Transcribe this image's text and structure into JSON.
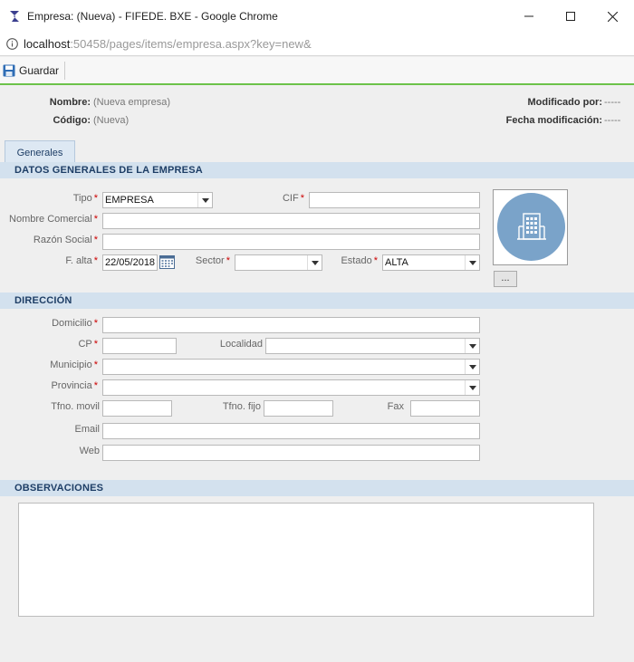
{
  "window": {
    "title": "Empresa: (Nueva) - FIFEDE. BXE - Google Chrome"
  },
  "address": {
    "host": "localhost",
    "rest": ":50458/pages/items/empresa.aspx?key=new&"
  },
  "toolbar": {
    "save_label": "Guardar"
  },
  "header": {
    "nombre_label": "Nombre:",
    "nombre_value": "(Nueva empresa)",
    "codigo_label": "Código:",
    "codigo_value": "(Nueva)",
    "modificado_label": "Modificado por:",
    "modificado_value": "-----",
    "fecha_label": "Fecha modificación:",
    "fecha_value": "-----"
  },
  "tabs": [
    {
      "label": "Generales"
    }
  ],
  "sections": {
    "datos": "DATOS GENERALES DE LA EMPRESA",
    "direccion": "DIRECCIÓN",
    "observaciones": "OBSERVACIONES"
  },
  "datos": {
    "tipo_label": "Tipo",
    "tipo_value": "EMPRESA",
    "cif_label": "CIF",
    "cif_value": "",
    "nombre_comercial_label": "Nombre Comercial",
    "nombre_comercial_value": "",
    "razon_social_label": "Razón Social",
    "razon_social_value": "",
    "falta_label": "F. alta",
    "falta_value": "22/05/2018",
    "sector_label": "Sector",
    "sector_value": "",
    "estado_label": "Estado",
    "estado_value": "ALTA",
    "photo_button_label": "..."
  },
  "direccion": {
    "domicilio_label": "Domicilio",
    "domicilio_value": "",
    "cp_label": "CP",
    "cp_value": "",
    "localidad_label": "Localidad",
    "localidad_value": "",
    "municipio_label": "Municipio",
    "municipio_value": "",
    "provincia_label": "Provincia",
    "provincia_value": "",
    "tfno_movil_label": "Tfno. movil",
    "tfno_movil_value": "",
    "tfno_fijo_label": "Tfno. fijo",
    "tfno_fijo_value": "",
    "fax_label": "Fax",
    "fax_value": "",
    "email_label": "Email",
    "email_value": "",
    "web_label": "Web",
    "web_value": ""
  },
  "observaciones": {
    "value": ""
  },
  "required_marker": "*",
  "colors": {
    "accent_line": "#6cc24a",
    "section_bg": "#d3e1ee",
    "section_text": "#1e3e66",
    "photo_circle": "#7aa3c9",
    "required": "#cc0000"
  }
}
